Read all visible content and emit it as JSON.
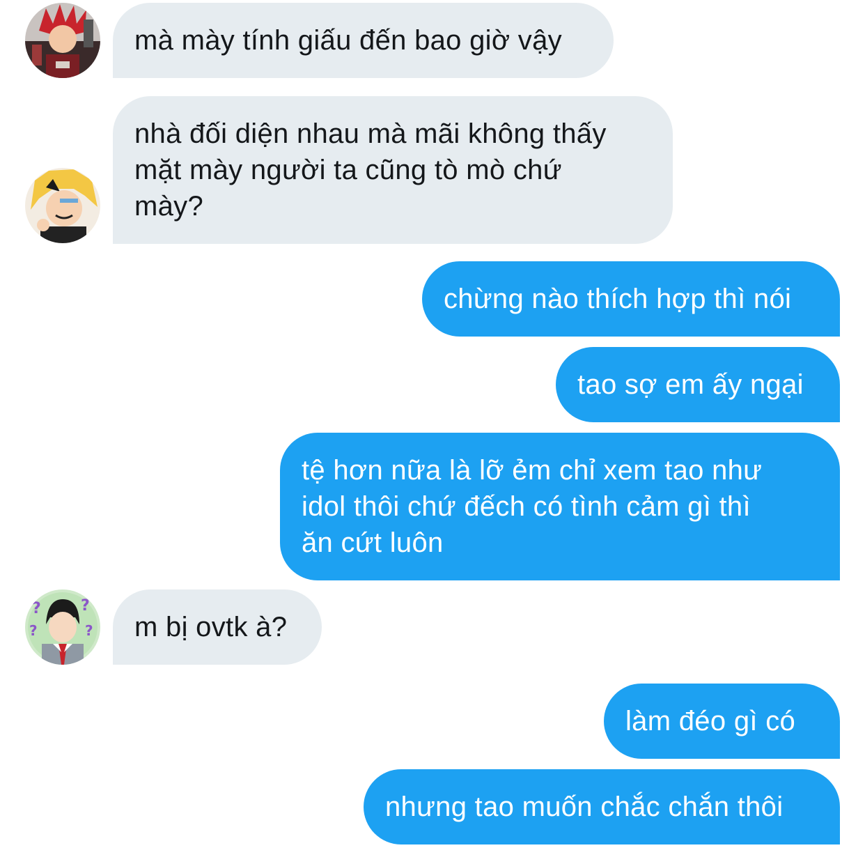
{
  "conversation": {
    "messages": [
      {
        "sender": "friend-1",
        "direction": "incoming",
        "text": "mà mày tính giấu đến bao giờ vậy"
      },
      {
        "sender": "friend-2",
        "direction": "incoming",
        "text": "nhà đối diện nhau mà mãi không thấy\nmặt mày người ta cũng tò mò chứ\nmày?"
      },
      {
        "sender": "me",
        "direction": "outgoing",
        "text": "chừng nào thích hợp thì nói"
      },
      {
        "sender": "me",
        "direction": "outgoing",
        "text": "tao sợ em ấy ngại"
      },
      {
        "sender": "me",
        "direction": "outgoing",
        "text": "tệ hơn nữa là lỡ ẻm chỉ xem tao như\nidol thôi chứ đếch có tình cảm gì thì\năn cứt luôn"
      },
      {
        "sender": "friend-3",
        "direction": "incoming",
        "text": "m bị ovtk à?"
      },
      {
        "sender": "me",
        "direction": "outgoing",
        "text": "làm đéo gì có"
      },
      {
        "sender": "me",
        "direction": "outgoing",
        "text": "nhưng tao muốn chắc chắn thôi"
      }
    ]
  },
  "colors": {
    "incoming_bubble": "#e6ecf0",
    "incoming_text": "#14171a",
    "outgoing_bubble": "#1da1f2",
    "outgoing_text": "#ffffff",
    "background": "#ffffff"
  },
  "avatars": [
    {
      "id": "friend-1",
      "icon": "red-spiky-hair-avatar-icon"
    },
    {
      "id": "friend-2",
      "icon": "blonde-hair-avatar-icon"
    },
    {
      "id": "friend-3",
      "icon": "question-marks-avatar-icon"
    }
  ]
}
